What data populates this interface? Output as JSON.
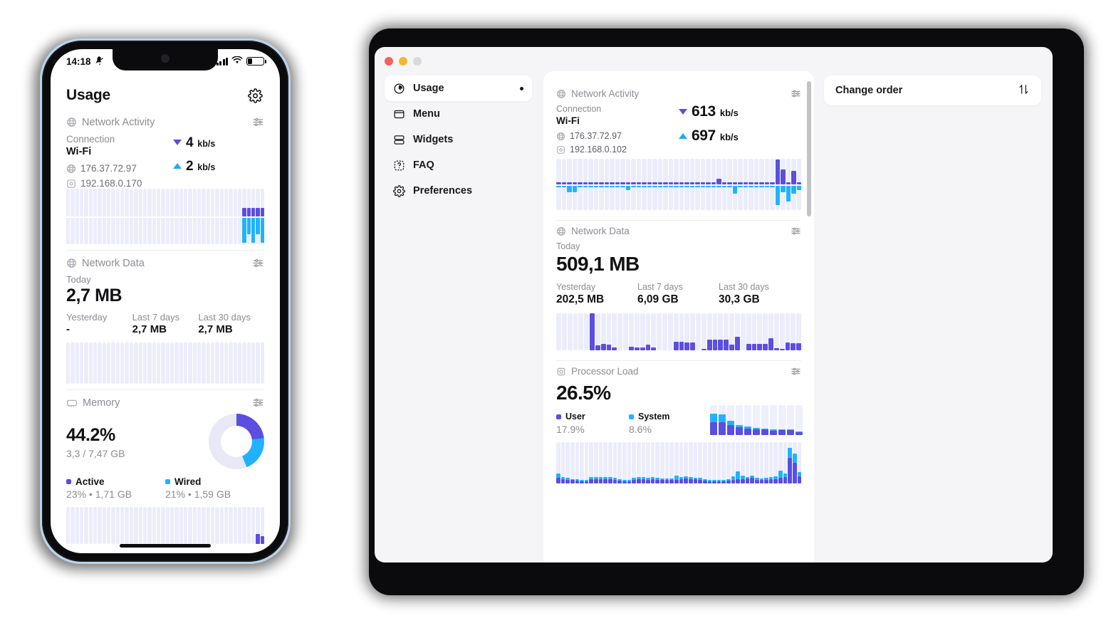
{
  "phone": {
    "status_bar": {
      "time": "14:18",
      "silent_icon": "bell-slash-icon",
      "signal_icon": "cellular-bars-icon",
      "wifi_icon": "wifi-icon",
      "battery_icon": "battery-low-icon"
    },
    "header": {
      "title": "Usage",
      "settings_icon": "gear-icon"
    },
    "network_activity": {
      "title": "Network Activity",
      "options_icon": "sliders-icon",
      "connection_label": "Connection",
      "connection_value": "Wi-Fi",
      "public_ip": "176.37.72.97",
      "local_ip": "192.168.0.170",
      "download": {
        "value": "4",
        "unit": "kb/s"
      },
      "upload": {
        "value": "2",
        "unit": "kb/s"
      }
    },
    "network_data": {
      "title": "Network Data",
      "options_icon": "sliders-icon",
      "today_label": "Today",
      "today_value": "2,7 MB",
      "stats": [
        {
          "label": "Yesterday",
          "value": "-"
        },
        {
          "label": "Last 7 days",
          "value": "2,7 MB"
        },
        {
          "label": "Last 30 days",
          "value": "2,7 MB"
        }
      ]
    },
    "memory": {
      "title": "Memory",
      "options_icon": "sliders-icon",
      "percent": "44.2%",
      "used_total": "3,3 / 7,47 GB",
      "legend": [
        {
          "label": "Active",
          "value": "23% • 1,71 GB",
          "color": "#5b4ee0"
        },
        {
          "label": "Wired",
          "value": "21% • 1,59 GB",
          "color": "#21b2ff"
        }
      ]
    }
  },
  "mac": {
    "traffic_lights": {
      "close": "close-button",
      "minimize": "minimize-button",
      "zoom": "zoom-button"
    },
    "sidebar": [
      {
        "label": "Usage",
        "icon": "clock-pie-icon",
        "active": true,
        "marker": true
      },
      {
        "label": "Menu",
        "icon": "menubar-icon",
        "active": false,
        "marker": false
      },
      {
        "label": "Widgets",
        "icon": "widgets-icon",
        "active": false,
        "marker": false
      },
      {
        "label": "FAQ",
        "icon": "question-icon",
        "active": false,
        "marker": false
      },
      {
        "label": "Preferences",
        "icon": "gear-icon",
        "active": false,
        "marker": false
      }
    ],
    "network_activity": {
      "title": "Network Activity",
      "options_icon": "sliders-icon",
      "connection_label": "Connection",
      "connection_value": "Wi-Fi",
      "public_ip": "176.37.72.97",
      "local_ip": "192.168.0.102",
      "download": {
        "value": "613",
        "unit": "kb/s"
      },
      "upload": {
        "value": "697",
        "unit": "kb/s"
      }
    },
    "network_data": {
      "title": "Network Data",
      "options_icon": "sliders-icon",
      "today_label": "Today",
      "today_value": "509,1 MB",
      "stats": [
        {
          "label": "Yesterday",
          "value": "202,5 MB"
        },
        {
          "label": "Last 7 days",
          "value": "6,09 GB"
        },
        {
          "label": "Last 30 days",
          "value": "30,3 GB"
        }
      ]
    },
    "processor": {
      "title": "Processor Load",
      "options_icon": "sliders-icon",
      "percent": "26.5%",
      "legend": [
        {
          "label": "User",
          "value": "17.9%",
          "color": "#5b4ee0"
        },
        {
          "label": "System",
          "value": "8.6%",
          "color": "#21b2ff"
        }
      ]
    },
    "order_panel": {
      "label": "Change order",
      "icon": "sort-arrows-icon"
    }
  },
  "colors": {
    "accent_purple": "#5b4ee0",
    "accent_cyan": "#21b2ff",
    "track": "#ecedfb",
    "text": "#121214",
    "muted": "#8c8c94"
  },
  "chart_data": [
    {
      "type": "bar",
      "name": "phone-network-activity",
      "title": "Network Activity (phone)",
      "bidirectional": true,
      "slots": 44,
      "ylabel": "kb/s",
      "up": [
        0,
        0,
        0,
        0,
        0,
        0,
        0,
        0,
        0,
        0,
        0,
        0,
        0,
        0,
        0,
        0,
        0,
        0,
        0,
        0,
        0,
        0,
        0,
        0,
        0,
        0,
        0,
        0,
        0,
        0,
        0,
        0,
        0,
        0,
        0,
        0,
        0,
        0,
        0,
        1,
        1,
        1,
        1,
        1
      ],
      "down": [
        0,
        0,
        0,
        0,
        0,
        0,
        0,
        0,
        0,
        0,
        0,
        0,
        0,
        0,
        0,
        0,
        0,
        0,
        0,
        0,
        0,
        0,
        0,
        0,
        0,
        0,
        0,
        0,
        0,
        0,
        0,
        0,
        0,
        0,
        0,
        0,
        0,
        0,
        0,
        3,
        2,
        3,
        2,
        3
      ]
    },
    {
      "type": "bar",
      "name": "phone-network-data",
      "title": "Network Data (phone)",
      "slots": 44,
      "values": [
        0,
        0,
        0,
        0,
        0,
        0,
        0,
        0,
        0,
        0,
        0,
        0,
        0,
        0,
        0,
        0,
        0,
        0,
        0,
        0,
        0,
        0,
        0,
        0,
        0,
        0,
        0,
        0,
        0,
        0,
        0,
        0,
        0,
        0,
        0,
        0,
        0,
        0,
        0,
        0,
        0,
        0,
        0,
        0
      ]
    },
    {
      "type": "bar",
      "name": "phone-memory",
      "title": "Memory (phone)",
      "slots": 44,
      "values": [
        0,
        0,
        0,
        0,
        0,
        0,
        0,
        0,
        0,
        0,
        0,
        0,
        0,
        0,
        0,
        0,
        0,
        0,
        0,
        0,
        0,
        0,
        0,
        0,
        0,
        0,
        0,
        0,
        0,
        0,
        0,
        0,
        0,
        0,
        0,
        0,
        0,
        0,
        0,
        0,
        0,
        0,
        26,
        22
      ]
    },
    {
      "type": "pie",
      "name": "phone-memory-donut",
      "title": "Memory breakdown",
      "labels": [
        "Active",
        "Wired",
        "Free"
      ],
      "values": [
        23,
        21,
        56
      ],
      "colors": [
        "#5b4ee0",
        "#21b2ff",
        "#e8e8f6"
      ]
    },
    {
      "type": "bar",
      "name": "mac-network-activity",
      "title": "Network Activity (mac)",
      "bidirectional": true,
      "slots": 46,
      "ylabel": "kb/s",
      "up": [
        2,
        2,
        2,
        2,
        2,
        2,
        2,
        2,
        2,
        2,
        2,
        2,
        2,
        2,
        2,
        2,
        2,
        2,
        2,
        2,
        2,
        2,
        2,
        2,
        2,
        2,
        2,
        2,
        2,
        2,
        6,
        2,
        2,
        2,
        2,
        2,
        2,
        2,
        2,
        2,
        2,
        26,
        16,
        2,
        14,
        2
      ],
      "down": [
        3,
        3,
        8,
        8,
        3,
        3,
        3,
        3,
        3,
        3,
        3,
        3,
        3,
        6,
        3,
        3,
        3,
        3,
        3,
        3,
        3,
        3,
        3,
        3,
        3,
        3,
        3,
        3,
        3,
        3,
        3,
        3,
        3,
        10,
        3,
        3,
        3,
        3,
        3,
        3,
        3,
        22,
        8,
        18,
        10,
        6
      ]
    },
    {
      "type": "bar",
      "name": "mac-network-data",
      "title": "Network Data (mac)",
      "slots": 44,
      "values": [
        0,
        0,
        0,
        0,
        0,
        0,
        55,
        7,
        10,
        9,
        4,
        0,
        0,
        5,
        4,
        4,
        9,
        4,
        0,
        0,
        0,
        13,
        13,
        12,
        12,
        0,
        2,
        16,
        16,
        16,
        16,
        8,
        20,
        0,
        10,
        10,
        10,
        10,
        18,
        3,
        2,
        12,
        11,
        11
      ]
    },
    {
      "type": "bar",
      "name": "mac-processor-mini",
      "title": "Processor Load recent (stacked)",
      "stacked": true,
      "slots": 11,
      "series": [
        {
          "name": "User",
          "values": [
            42,
            42,
            34,
            26,
            22,
            20,
            18,
            15,
            16,
            16,
            9
          ]
        },
        {
          "name": "System",
          "values": [
            30,
            28,
            14,
            7,
            6,
            5,
            4,
            3,
            4,
            4,
            2
          ]
        }
      ]
    },
    {
      "type": "bar",
      "name": "mac-processor-history",
      "title": "Processor Load history (stacked)",
      "stacked": true,
      "slots": 52,
      "series": [
        {
          "name": "User",
          "values": [
            14,
            10,
            9,
            8,
            7,
            6,
            6,
            10,
            11,
            11,
            11,
            10,
            9,
            7,
            6,
            5,
            9,
            10,
            10,
            9,
            10,
            9,
            8,
            8,
            8,
            9,
            10,
            12,
            11,
            10,
            9,
            7,
            6,
            6,
            5,
            6,
            7,
            9,
            10,
            11,
            12,
            14,
            9,
            8,
            9,
            10,
            11,
            13,
            16,
            62,
            50,
            18
          ]
        },
        {
          "name": "System",
          "values": [
            10,
            5,
            4,
            3,
            3,
            3,
            3,
            5,
            5,
            5,
            5,
            5,
            4,
            3,
            3,
            3,
            4,
            5,
            5,
            4,
            5,
            4,
            4,
            4,
            4,
            10,
            5,
            5,
            4,
            4,
            4,
            3,
            3,
            3,
            3,
            3,
            4,
            9,
            20,
            8,
            4,
            5,
            4,
            4,
            5,
            5,
            6,
            18,
            9,
            24,
            22,
            10
          ]
        }
      ]
    }
  ]
}
